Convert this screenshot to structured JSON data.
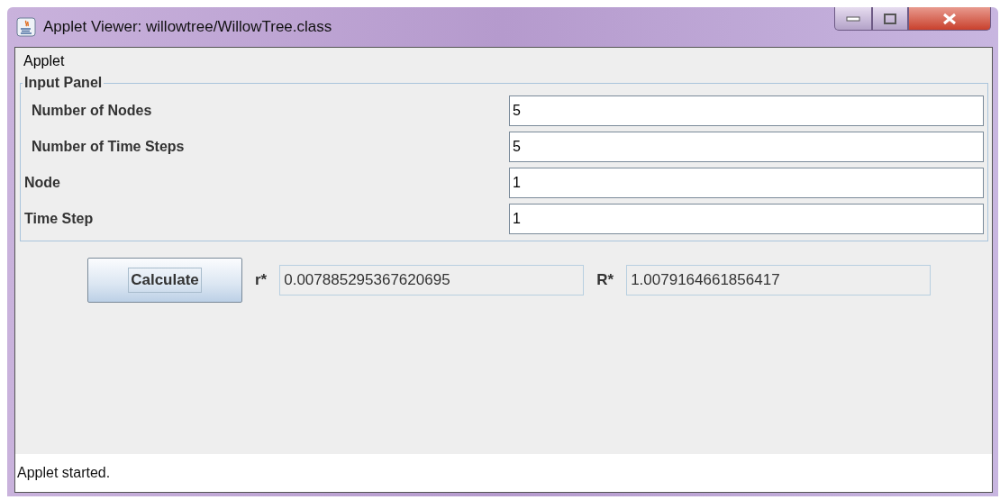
{
  "window": {
    "title": "Applet Viewer: willowtree/WillowTree.class"
  },
  "menu": [
    "Applet"
  ],
  "input_panel": {
    "title": "Input Panel",
    "fields": [
      {
        "label": "Number of Nodes",
        "value": "5",
        "indented": true
      },
      {
        "label": "Number of Time Steps",
        "value": "5",
        "indented": true
      },
      {
        "label": "Node",
        "value": "1",
        "indented": false
      },
      {
        "label": "Time Step",
        "value": "1",
        "indented": false
      }
    ]
  },
  "calculate_button": "Calculate",
  "outputs": [
    {
      "label": "r*",
      "value": "0.007885295367620695"
    },
    {
      "label": "R*",
      "value": "1.0079164661856417"
    }
  ],
  "status_bar": "Applet started."
}
